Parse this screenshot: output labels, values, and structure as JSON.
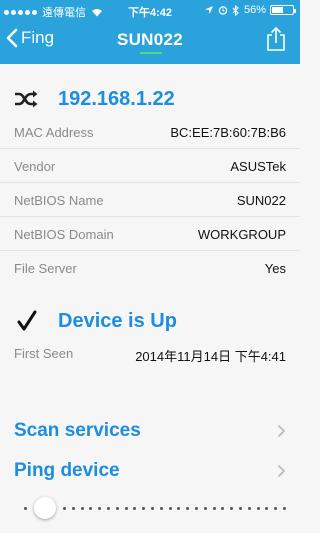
{
  "status_bar": {
    "carrier": "遠傳電信",
    "time": "下午4:42",
    "battery_percent": "56%",
    "battery_level": 0.56
  },
  "nav": {
    "back_label": "Fing",
    "title": "SUN022",
    "share_icon": "share-icon"
  },
  "device": {
    "ip": "192.168.1.22",
    "details": [
      {
        "label": "MAC Address",
        "value": "BC:EE:7B:60:7B:B6"
      },
      {
        "label": "Vendor",
        "value": "ASUSTek"
      },
      {
        "label": "NetBIOS Name",
        "value": "SUN022"
      },
      {
        "label": "NetBIOS Domain",
        "value": "WORKGROUP"
      },
      {
        "label": "File Server",
        "value": "Yes"
      }
    ],
    "status": "Device is Up",
    "first_seen_label": "First Seen",
    "first_seen_value": "2014年11月14日 下午4:41"
  },
  "actions": [
    {
      "label": "Scan services"
    },
    {
      "label": "Ping device"
    }
  ],
  "colors": {
    "header": "#2aa3dc",
    "accent": "#1c8ddf",
    "indicator": "#46e07a"
  }
}
